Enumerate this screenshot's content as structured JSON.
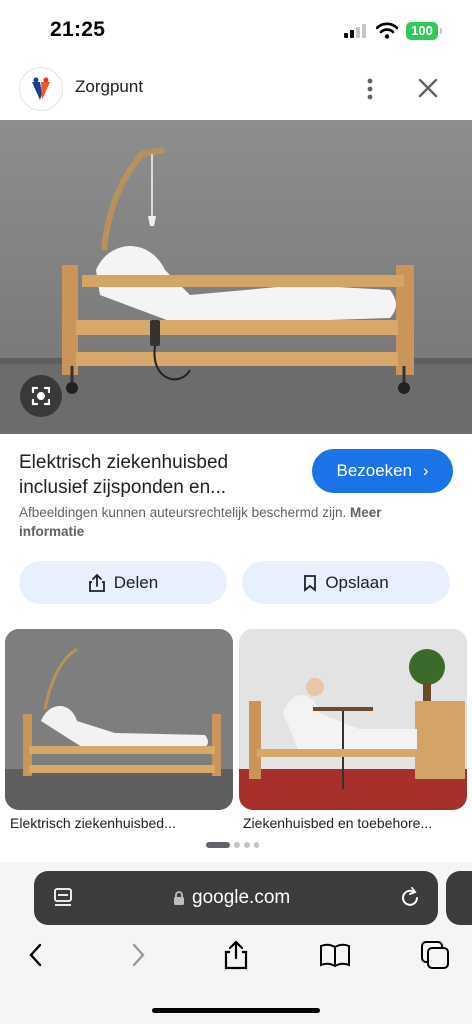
{
  "status_bar": {
    "time": "21:25",
    "battery": "100"
  },
  "header": {
    "site_name": "Zorgpunt",
    "logo": "zorgpunt-logo",
    "more_icon": "more-vertical-icon",
    "close_icon": "close-icon"
  },
  "result": {
    "title": "Elektrisch ziekenhuisbed inclusief zijsponden en...",
    "visit_label": "Bezoeken",
    "copyright_text": "Afbeeldingen kunnen auteursrechtelijk beschermd zijn.",
    "copyright_link": "Meer informatie",
    "share_label": "Delen",
    "save_label": "Opslaan"
  },
  "related": [
    {
      "caption": "Elektrisch ziekenhuisbed..."
    },
    {
      "caption": "Ziekenhuisbed en toebehore..."
    }
  ],
  "browser": {
    "url": "google.com"
  },
  "colors": {
    "accent": "#1a73e8",
    "pill_bg": "#e8f0fe",
    "url_bar": "#3c3c3c"
  }
}
